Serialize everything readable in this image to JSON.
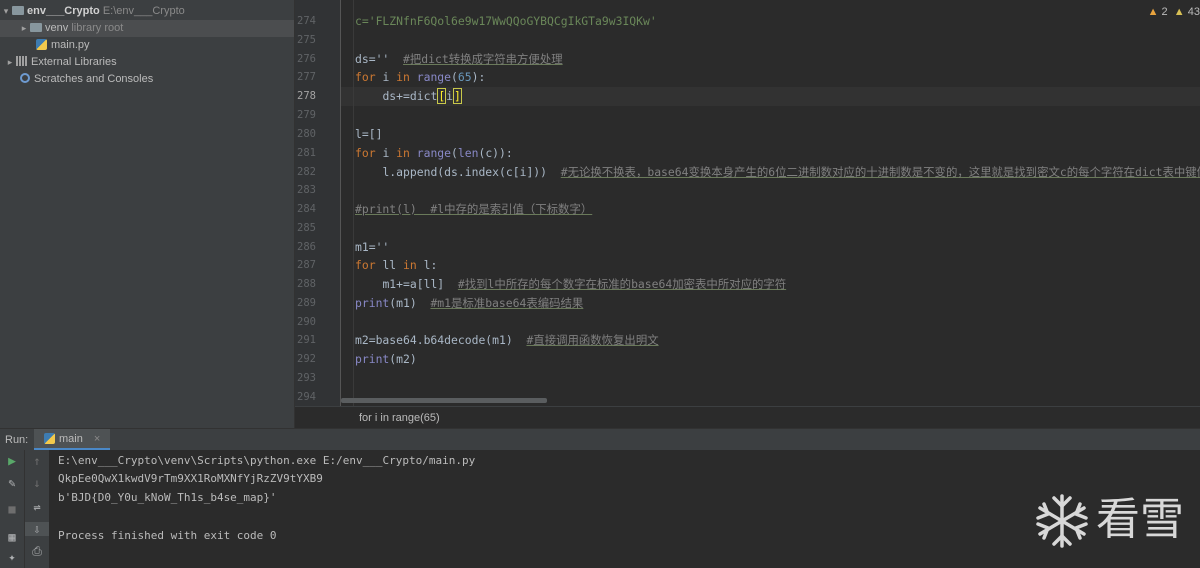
{
  "project": {
    "root_name": "env___Crypto",
    "root_path": "E:\\env___Crypto",
    "items": [
      {
        "label": "venv",
        "suffix": "library root"
      },
      {
        "label": "main.py"
      },
      {
        "label": "External Libraries"
      },
      {
        "label": "Scratches and Consoles"
      }
    ]
  },
  "editor": {
    "inspection": {
      "warnings": "2",
      "weak_warnings": "43"
    },
    "lines": [
      {
        "n": "273"
      },
      {
        "n": "274"
      },
      {
        "n": "275"
      },
      {
        "n": "276"
      },
      {
        "n": "277"
      },
      {
        "n": "278"
      },
      {
        "n": "279"
      },
      {
        "n": "280"
      },
      {
        "n": "281"
      },
      {
        "n": "282"
      },
      {
        "n": "283"
      },
      {
        "n": "284"
      },
      {
        "n": "285"
      },
      {
        "n": "286"
      },
      {
        "n": "287"
      },
      {
        "n": "288"
      },
      {
        "n": "289"
      },
      {
        "n": "290"
      },
      {
        "n": "291"
      },
      {
        "n": "292"
      },
      {
        "n": "293"
      },
      {
        "n": "294"
      }
    ],
    "code": {
      "l274": "c='FLZNfnF6Qol6e9w17WwQQoGYBQCgIkGTa9w3IQKw'",
      "l276_a": "ds=''",
      "l276_c": "#把dict转换成字符串方便处理",
      "l277_kw": "for",
      "l277_a": "i",
      "l277_in": "in",
      "l277_fn": "range",
      "l277_num": "65",
      "l278_a": "ds+=dict",
      "l278_b": "i",
      "l280": "l=[]",
      "l281_kw": "for",
      "l281_a": "i",
      "l281_in": "in",
      "l281_fn": "range",
      "l281_fn2": "len",
      "l281_b": "(c)):",
      "l282_a": "l.append(ds.index(c[i]))",
      "l282_c": "#无论换不换表，base64变换本身产生的6位二进制数对应的十进制数是不变的，这里就是找到密文c的每个字符在dict表中键值",
      "l284": "#print(l)  #l中存的是索引值（下标数字）",
      "l286": "m1=''",
      "l287_kw": "for",
      "l287_a": "ll",
      "l287_in": "in",
      "l287_b": "l:",
      "l288_a": "m1+=a[ll]",
      "l288_c": "#找到l中所存的每个数字在标准的base64加密表中所对应的字符",
      "l289_fn": "print",
      "l289_a": "(m1)",
      "l289_c": "#m1是标准base64表编码结果",
      "l291_a": "m2=base64.b64decode(m1)",
      "l291_c": "#直接调用函数恢复出明文",
      "l292_fn": "print",
      "l292_a": "(m2)"
    },
    "breadcrumb": "for i in range(65)"
  },
  "run": {
    "label": "Run:",
    "tab": "main",
    "console": [
      "E:\\env___Crypto\\venv\\Scripts\\python.exe E:/env___Crypto/main.py",
      "QkpEe0QwX1kwdV9rTm9XX1RoMXNfYjRzZV9tYXB9",
      "b'BJD{D0_Y0u_kNoW_Th1s_b4se_map}'",
      "",
      "Process finished with exit code 0"
    ]
  },
  "watermark": {
    "text": "看雪"
  }
}
